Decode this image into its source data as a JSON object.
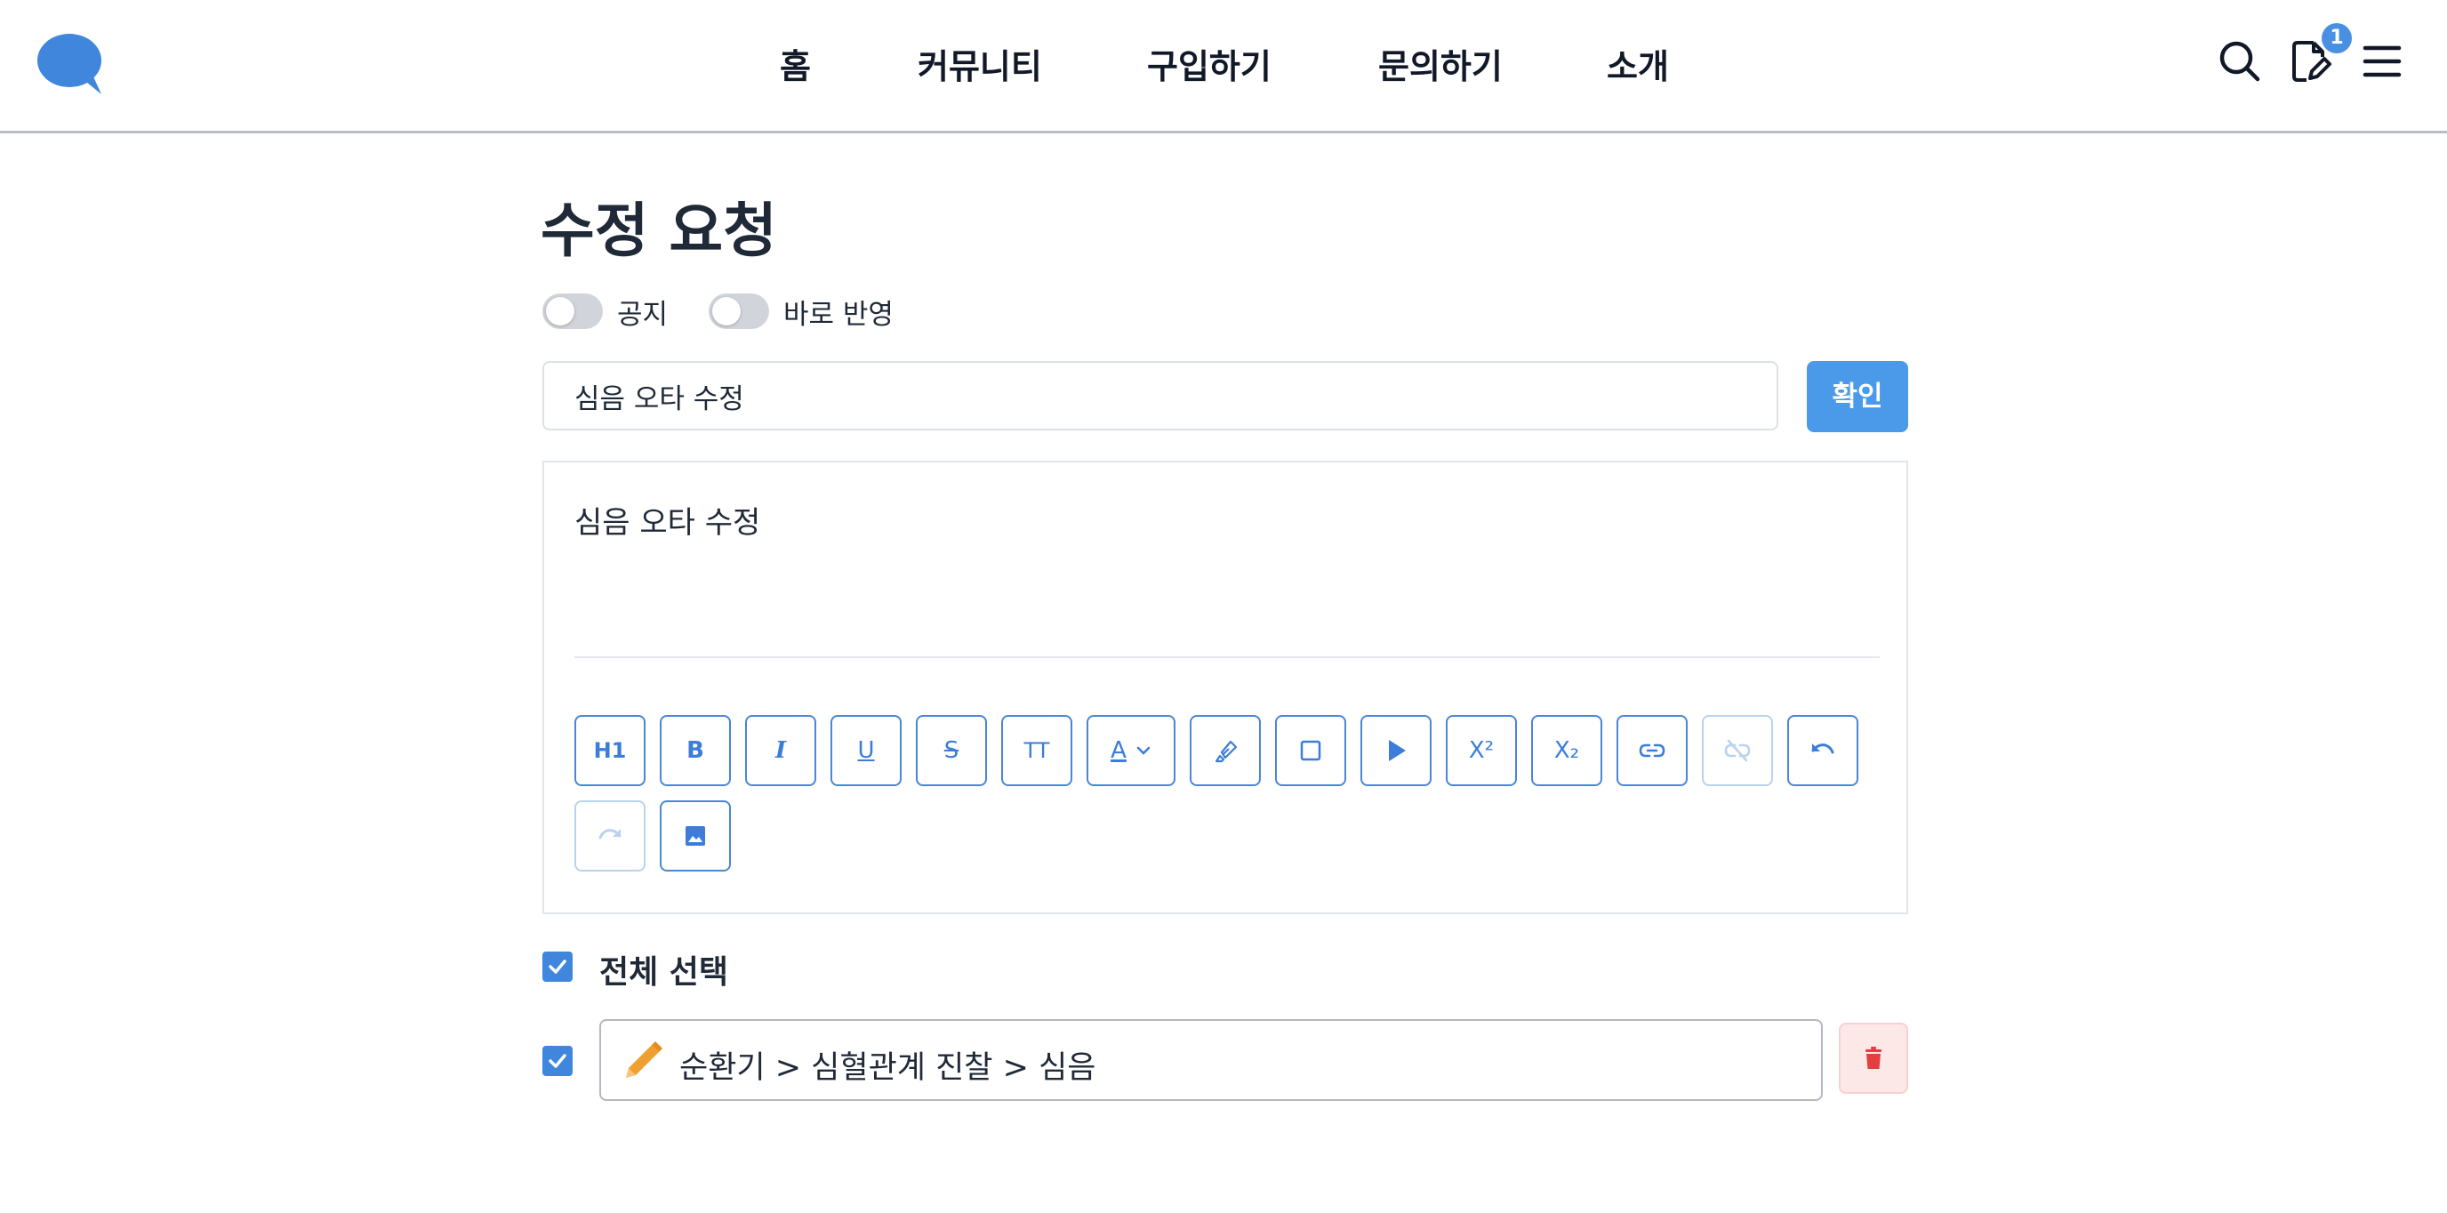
{
  "colors": {
    "accent": "#4a90e2",
    "danger": "#e53e3e",
    "pencil": "#f0a030"
  },
  "header": {
    "logo_icon": "speech-bubble-icon",
    "nav": [
      "홈",
      "커뮤니티",
      "구입하기",
      "문의하기",
      "소개"
    ],
    "icons": [
      "search-icon",
      "document-edit-icon",
      "menu-icon"
    ],
    "notification_count": "1"
  },
  "page": {
    "title": "수정 요청",
    "toggles": {
      "notice": {
        "label": "공지",
        "on": false
      },
      "apply_now": {
        "label": "바로 반영",
        "on": false
      }
    }
  },
  "form": {
    "title_value": "심음 오타 수정",
    "confirm_label": "확인",
    "editor_content": "심음 오타 수정"
  },
  "toolbar": {
    "heading": "H1",
    "bold": "B",
    "italic": "I",
    "underline": "U",
    "strike": "S",
    "font_size": "TT",
    "text_color": "A",
    "superscript": "X²",
    "subscript": "X₂",
    "buttons": [
      "heading-icon",
      "bold-icon",
      "italic-icon",
      "underline-icon",
      "strikethrough-icon",
      "font-size-icon",
      "text-color-icon",
      "highlighter-icon",
      "box-icon",
      "play-icon",
      "superscript-icon",
      "subscript-icon",
      "link-icon",
      "unlink-icon",
      "undo-icon",
      "redo-icon",
      "image-icon"
    ],
    "disabled": [
      "unlink-icon",
      "redo-icon"
    ]
  },
  "selection": {
    "select_all_label": "전체 선택",
    "select_all_checked": true,
    "items": [
      {
        "path": "순환기 > 심혈관계 진찰 > 심음",
        "checked": true,
        "icon": "pencil-icon"
      }
    ]
  }
}
